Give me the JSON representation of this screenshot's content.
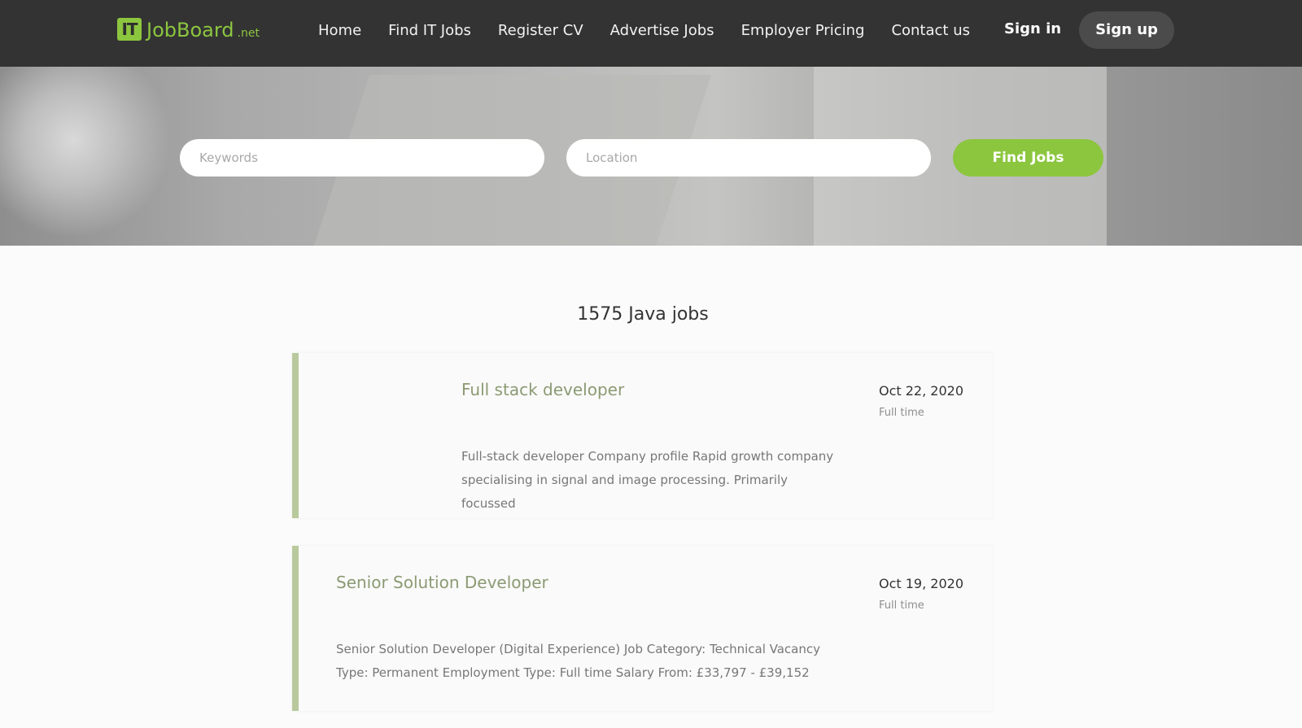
{
  "brand": {
    "badge": "IT",
    "name": "JobBoard",
    "suffix": ".net"
  },
  "nav": {
    "items": [
      {
        "label": "Home"
      },
      {
        "label": "Find IT Jobs"
      },
      {
        "label": "Register CV"
      },
      {
        "label": "Advertise Jobs"
      },
      {
        "label": "Employer Pricing"
      },
      {
        "label": "Contact us"
      }
    ],
    "signin": "Sign in",
    "signup": "Sign up"
  },
  "search": {
    "keywords_placeholder": "Keywords",
    "keywords_value": "",
    "location_placeholder": "Location",
    "location_value": "",
    "button": "Find Jobs"
  },
  "results": {
    "title": "1575 Java jobs",
    "jobs": [
      {
        "title": "Full stack developer",
        "date": "Oct 22, 2020",
        "type": "Full time",
        "description": "Full-stack developer Company profile Rapid growth company specialising in signal and image processing. Primarily focussed"
      },
      {
        "title": "Senior Solution Developer",
        "date": "Oct 19, 2020",
        "type": "Full time",
        "description": "Senior Solution Developer (Digital Experience) Job Category: Technical Vacancy Type: Permanent Employment Type: Full time Salary From: £33,797 - £39,152"
      }
    ]
  },
  "colors": {
    "accent": "#8cc63f",
    "topbar": "#333333",
    "title_green": "#8b9a73"
  }
}
